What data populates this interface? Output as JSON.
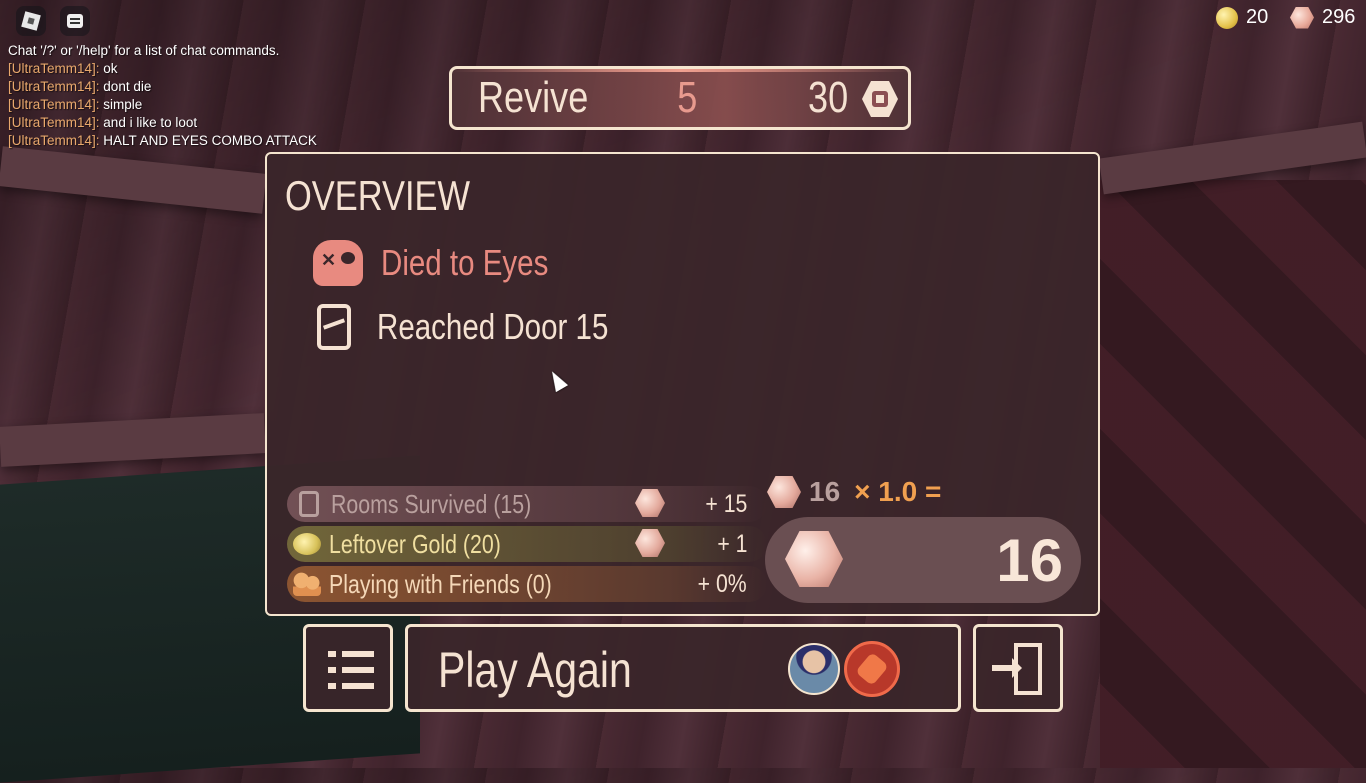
{
  "topbar": {
    "gold_count": "20",
    "knobs_count": "296"
  },
  "chat": {
    "system_message": "Chat '/?' or '/help' for a list of chat commands.",
    "messages": [
      {
        "name": "[UltraTemm14]:",
        "text": "ok"
      },
      {
        "name": "[UltraTemm14]:",
        "text": "dont die"
      },
      {
        "name": "[UltraTemm14]:",
        "text": "simple"
      },
      {
        "name": "[UltraTemm14]:",
        "text": "and i like to loot"
      },
      {
        "name": "[UltraTemm14]:",
        "text": "HALT AND EYES COMBO ATTACK"
      }
    ]
  },
  "revive": {
    "label": "Revive",
    "count": "5",
    "price": "30",
    "price_icon": "robux-icon"
  },
  "overview": {
    "title": "OVERVIEW",
    "death_text": "Died to Eyes",
    "door_text": "Reached Door 15",
    "bonuses": [
      {
        "label": "Rooms Survived (15)",
        "value": "+ 15",
        "icon": "door-icon"
      },
      {
        "label": "Leftover Gold (20)",
        "value": "+ 1",
        "icon": "gold-icon"
      },
      {
        "label": "Playing with Friends (0)",
        "value": "+ 0%",
        "icon": "friends-icon"
      }
    ],
    "formula": {
      "base": "16",
      "multiplier": "× 1.0 ="
    },
    "total": "16"
  },
  "buttons": {
    "play_again": "Play Again"
  },
  "colors": {
    "accent_border": "#f5e5cf",
    "panel_bg": "#3a262a",
    "death_red": "#e88a80",
    "multiplier_orange": "#f0a050"
  }
}
